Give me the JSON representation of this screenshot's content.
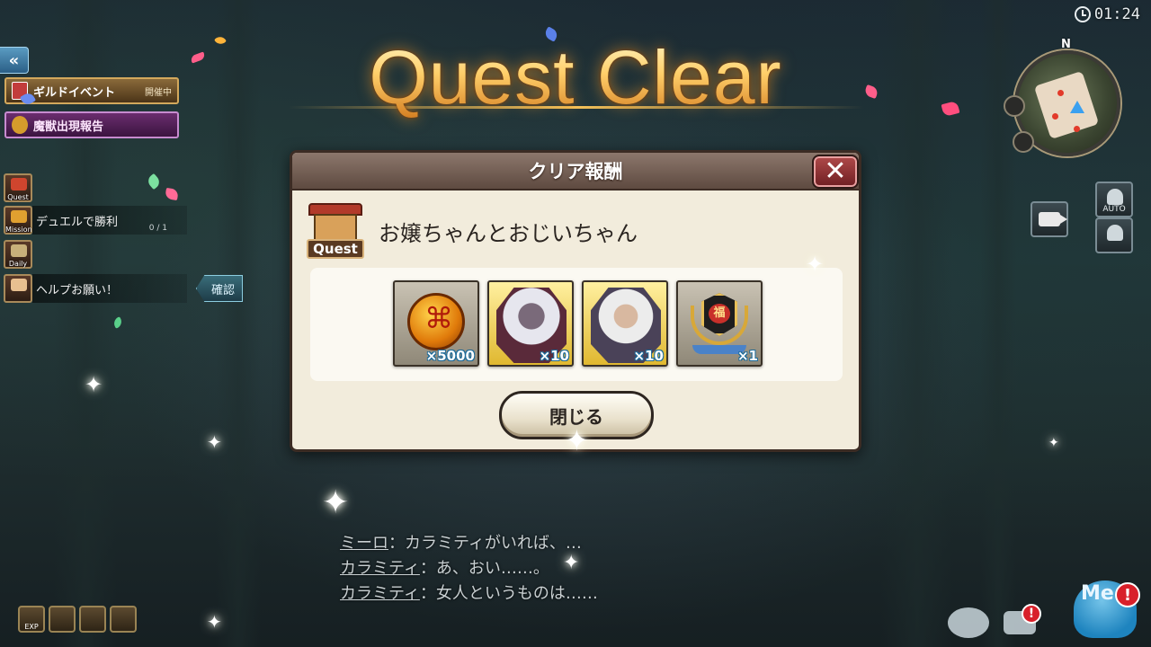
{
  "clock": {
    "time": "01:24"
  },
  "title": "Quest Clear",
  "left_panel": {
    "guild_event": {
      "label": "ギルドイベント",
      "badge": "開催中"
    },
    "beast_report": {
      "label": "魔獣出現報告"
    },
    "menu": [
      {
        "icon": "Quest",
        "text": ""
      },
      {
        "icon": "Mission",
        "text": "デュエルで勝利",
        "progress": "0 / 1"
      },
      {
        "icon": "Daily",
        "text": ""
      },
      {
        "icon": "",
        "text": "ヘルプお願い！"
      }
    ],
    "confirm_label": "確認"
  },
  "minimap": {
    "north_label": "N"
  },
  "right_panel": {
    "auto_label": "AUTO"
  },
  "dialog": {
    "header": "クリア報酬",
    "quest_badge": "Quest",
    "quest_name": "お嬢ちゃんとおじいちゃん",
    "rewards": [
      {
        "icon": "gold-coin-icon",
        "qty": "×5000"
      },
      {
        "icon": "girl-portrait-icon",
        "qty": "×10"
      },
      {
        "icon": "oldman-portrait-icon",
        "qty": "×10"
      },
      {
        "icon": "fortune-medal-icon",
        "qty": "×1",
        "medal_text": "福"
      }
    ],
    "close_label": "閉じる"
  },
  "conversation": [
    {
      "speaker": "ミーロ",
      "line": "：カラミティがいれば、…"
    },
    {
      "speaker": "カラミティ",
      "line": "：あ、おい……。"
    },
    {
      "speaker": "カラミティ",
      "line": "：女人というものは……"
    }
  ],
  "bottom_left": {
    "exp_label": "EXP"
  },
  "bottom_right": {
    "alert_mark": "!",
    "mascot_label": "Me"
  },
  "colors": {
    "title_gold": "#ffcf6a",
    "dialog_bg": "#f2ecdc",
    "close_red": "#b04a4a",
    "qty_outline": "#1d6b9a"
  }
}
